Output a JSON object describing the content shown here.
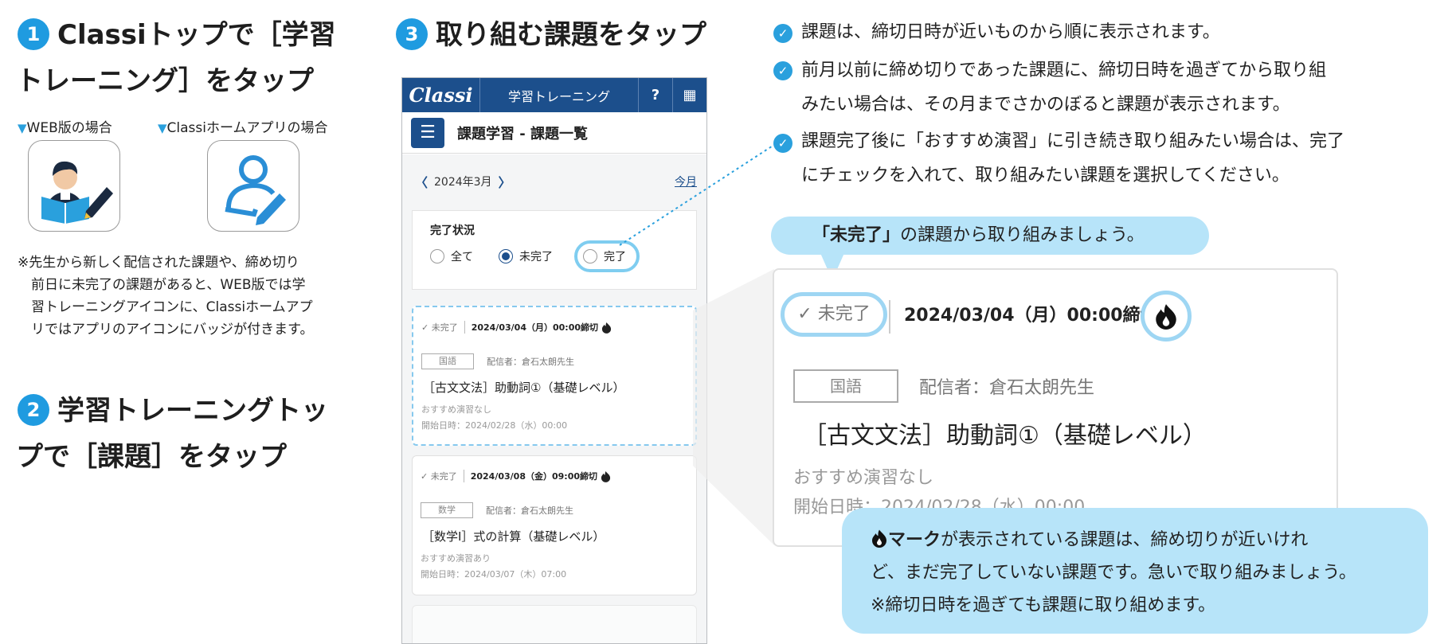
{
  "step1": {
    "number": "1",
    "line1": "Classiトップで［学習",
    "line2": "トレーニング］をタップ",
    "web_label": "WEB版の場合",
    "app_label": "Classiホームアプリの場合",
    "tri": "▼",
    "note_lines": [
      "※先生から新しく配信された課題や、締め切り",
      "前日に未完了の課題があると、WEB版では学",
      "習トレーニングアイコンに、Classiホームアプ",
      "リではアプリのアイコンにバッジが付きます。"
    ]
  },
  "step2": {
    "number": "2",
    "line1": "学習トレーニングトッ",
    "line2": "プで［課題］をタップ"
  },
  "step3": {
    "number": "3",
    "title": "取り組む課題をタップ"
  },
  "phone": {
    "logo": "Classi",
    "app_title": "学習トレーニング",
    "help_btn": "?",
    "grid_btn": "▦",
    "menu_icon": "☰",
    "page_title": "課題学習 - 課題一覧",
    "prev": "〈",
    "month": "2024年3月",
    "next": "〉",
    "today": "今月",
    "filter_title": "完了状況",
    "radios": [
      "全て",
      "未完了",
      "完了"
    ],
    "selected_radio": "未完了",
    "cards": [
      {
        "status": "✓ 未完了",
        "deadline": "2024/03/04（月）00:00締切",
        "subject": "国語",
        "from": "配信者：倉石太朗先生",
        "title": "［古文文法］助動詞①（基礎レベル）",
        "rec": "おすすめ演習なし",
        "start": "開始日時：2024/02/28（水）00:00"
      },
      {
        "status": "✓ 未完了",
        "deadline": "2024/03/08（金）09:00締切",
        "subject": "数学",
        "from": "配信者：倉石太朗先生",
        "title": "［数学Ⅰ］式の計算（基礎レベル）",
        "rec": "おすすめ演習あり",
        "start": "開始日時：2024/03/07（木）07:00"
      }
    ]
  },
  "bullets": [
    {
      "lines": [
        "課題は、締切日時が近いものから順に表示されます。"
      ]
    },
    {
      "lines": [
        "前月以前に締め切りであった課題に、締切日時を過ぎてから取り組",
        "みたい場合は、その月までさかのぼると課題が表示されます。"
      ]
    },
    {
      "lines": [
        "課題完了後に「おすすめ演習」に引き続き取り組みたい場合は、完了",
        "にチェックを入れて、取り組みたい課題を選択してください。"
      ]
    }
  ],
  "callout_top": {
    "bold": "「未完了」",
    "rest": "の課題から取り組みましょう。"
  },
  "zoom": {
    "status": "✓ 未完了",
    "deadline": "2024/03/04（月）00:00締切",
    "subject": "国語",
    "from": "配信者：倉石太朗先生",
    "title": "［古文文法］助動詞①（基礎レベル）",
    "rec": "おすすめ演習なし",
    "start": "開始日時：2024/02/28（水）00:00"
  },
  "callout_bottom": {
    "bold": "マーク",
    "line1_rest": "が表示されている課題は、締め切りが近いけれ",
    "line2": "ど、まだ完了していない課題です。急いで取り組みましょう。",
    "line3": "※締切日時を過ぎても課題に取り組めます。"
  },
  "colors": {
    "accent": "#1f9be0",
    "phone_bar": "#1c4f8c",
    "callout": "#b7e4f9",
    "highlight": "#9ed6f3"
  },
  "icons": [
    "check-circle-icon",
    "flame-icon",
    "student-icon",
    "person-pen-icon",
    "grid-icon",
    "menu-icon",
    "chevron-left-icon",
    "chevron-right-icon"
  ]
}
